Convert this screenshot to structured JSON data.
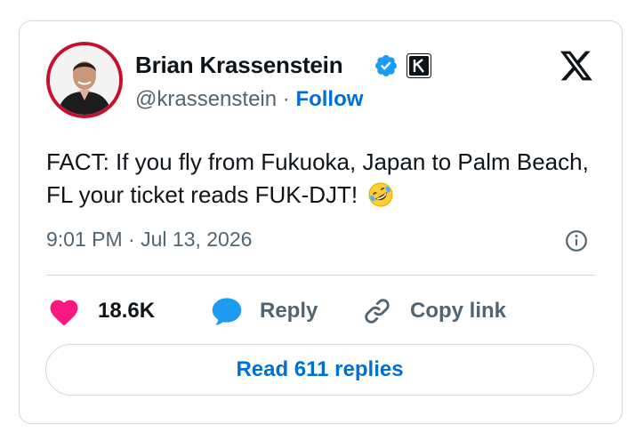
{
  "tweet": {
    "author_name": "Brian Krassenstein",
    "handle": "@krassenstein",
    "separator": "·",
    "follow_label": "Follow",
    "text": "FACT: If you fly from Fukuoka, Japan to Palm Beach, FL your ticket reads FUK-DJT!",
    "emoji": "rolling-on-floor-laughing-emoji",
    "time": "9:01 PM",
    "date": "Jul 13, 2026",
    "meta_separator": "·"
  },
  "actions": {
    "like_count": "18.6K",
    "reply_label": "Reply",
    "copy_link_label": "Copy link"
  },
  "footer": {
    "read_replies_label": "Read 611 replies"
  },
  "colors": {
    "like": "#f91880",
    "reply": "#1d9bf0",
    "verified": "#1d9bf0",
    "link": "#006fd6",
    "avatar_ring": "#c7102e"
  },
  "icons": [
    "verified-badge-icon",
    "affiliate-badge-icon",
    "x-logo-icon",
    "info-icon",
    "heart-icon",
    "reply-bubble-icon",
    "link-icon"
  ]
}
